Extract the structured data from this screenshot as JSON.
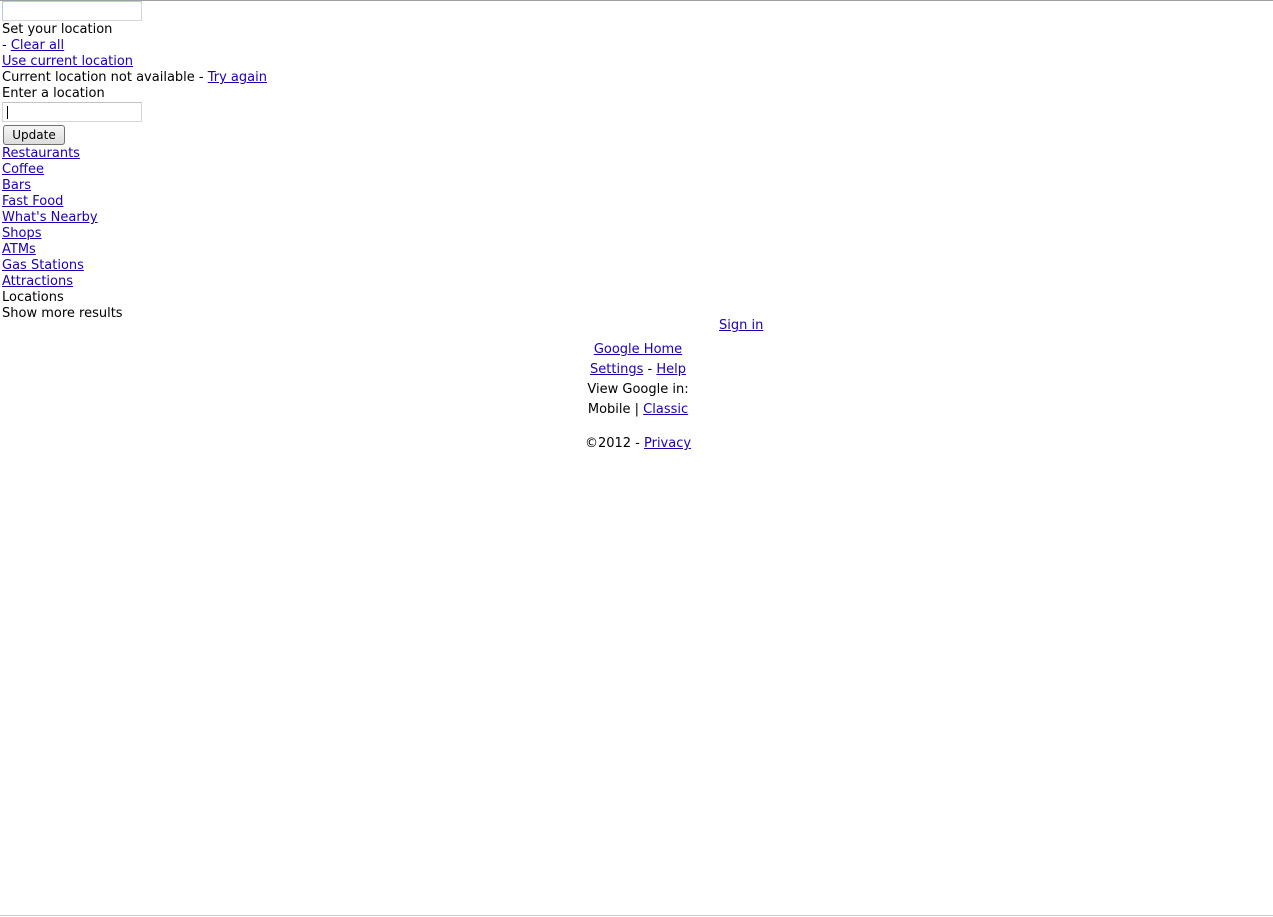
{
  "location_panel": {
    "search_value": "",
    "set_location_label": "Set your location",
    "clear_prefix": "- ",
    "clear_all": "Clear all",
    "use_current_location": "Use current location",
    "not_available_text": "Current location not available - ",
    "try_again": "Try again",
    "enter_location_label": "Enter a location",
    "location_value": "",
    "update_button": "Update"
  },
  "categories": [
    "Restaurants",
    "Coffee",
    "Bars",
    "Fast Food",
    "What's Nearby",
    "Shops",
    "ATMs",
    "Gas Stations",
    "Attractions"
  ],
  "locations_label": "Locations",
  "show_more_results": "Show more results",
  "footer": {
    "sign_in": "Sign in",
    "google_home": "Google Home",
    "settings": "Settings",
    "separator_dash": " - ",
    "help": "Help",
    "view_google_in": "View Google in:",
    "mobile": "Mobile",
    "pipe": " | ",
    "classic": "Classic",
    "copyright": "©2012 - ",
    "privacy": "Privacy"
  },
  "colors": {
    "link": "#1c00b4",
    "text": "#000000",
    "background": "#ffffff"
  }
}
